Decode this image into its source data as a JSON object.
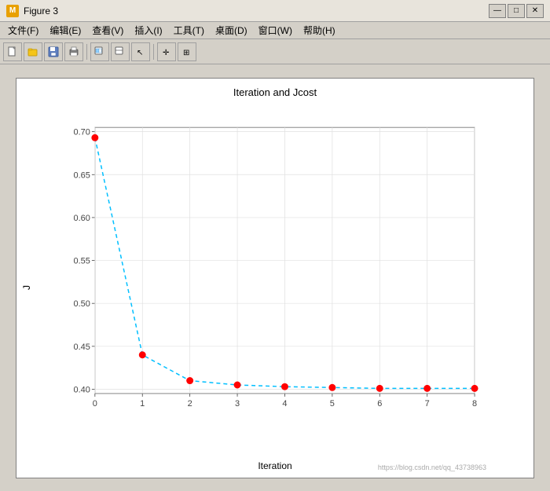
{
  "window": {
    "title": "Figure 3",
    "icon_label": "M"
  },
  "title_buttons": {
    "minimize": "—",
    "maximize": "□",
    "close": "✕"
  },
  "menu": {
    "items": [
      {
        "label": "文件(F)"
      },
      {
        "label": "编辑(E)"
      },
      {
        "label": "查看(V)"
      },
      {
        "label": "插入(I)"
      },
      {
        "label": "工具(T)"
      },
      {
        "label": "桌面(D)"
      },
      {
        "label": "窗口(W)"
      },
      {
        "label": "帮助(H)"
      }
    ]
  },
  "plot": {
    "title": "Iteration and Jcost",
    "x_label": "Iteration",
    "y_label": "J",
    "watermark": "https://blog.csdn.net/qq_43738963",
    "x_ticks": [
      0,
      1,
      2,
      3,
      4,
      5,
      6,
      7,
      8
    ],
    "y_ticks": [
      0.4,
      0.45,
      0.5,
      0.55,
      0.6,
      0.65,
      0.7
    ],
    "data_points": [
      {
        "x": 0,
        "y": 0.693
      },
      {
        "x": 1,
        "y": 0.44
      },
      {
        "x": 2,
        "y": 0.41
      },
      {
        "x": 3,
        "y": 0.405
      },
      {
        "x": 4,
        "y": 0.403
      },
      {
        "x": 5,
        "y": 0.402
      },
      {
        "x": 6,
        "y": 0.401
      },
      {
        "x": 7,
        "y": 0.401
      },
      {
        "x": 8,
        "y": 0.401
      }
    ],
    "y_min": 0.395,
    "y_max": 0.705,
    "x_min": 0,
    "x_max": 8,
    "accent_color": "#00BFFF",
    "dot_color": "#FF0000"
  }
}
